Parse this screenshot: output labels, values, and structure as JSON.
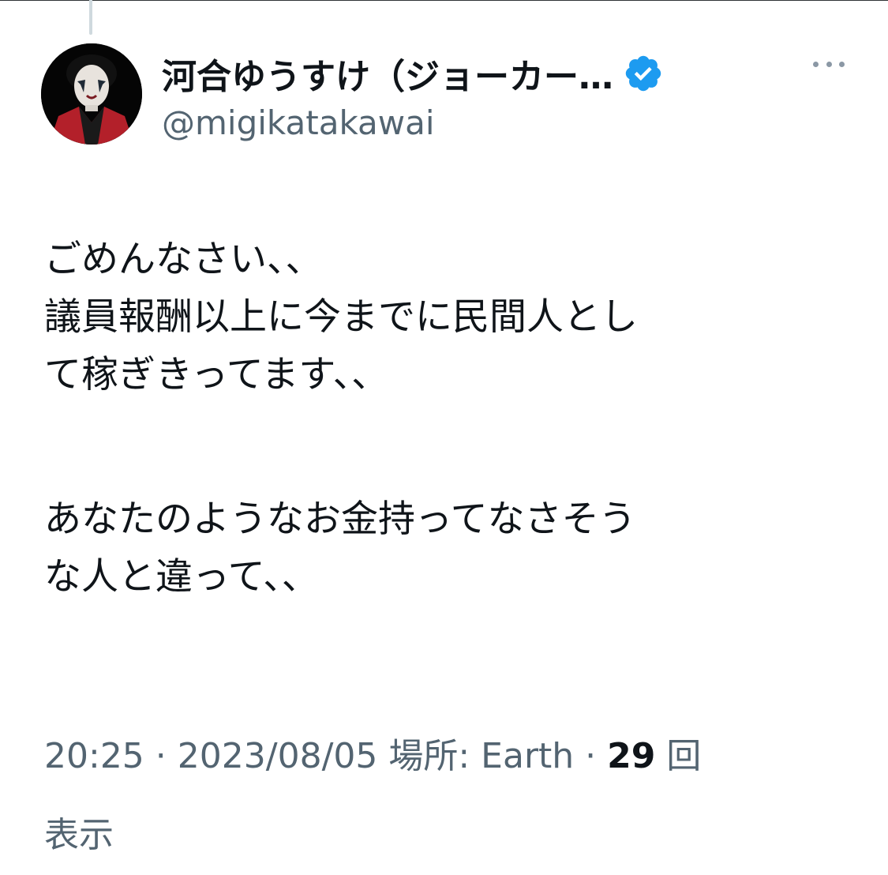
{
  "tweet": {
    "author": {
      "display_name": "河合ゆうすけ（ジョーカー…",
      "handle": "@migikatakawai",
      "verified": true,
      "verified_color": "#1d9bf0"
    },
    "more_icon": "more-horizontal-icon",
    "text_lines": [
      "ごめんなさい、、",
      "議員報酬以上に今までに民間人とし",
      "て稼ぎきってます、、",
      "",
      "あなたのようなお金持ってなさそう",
      "な人と違って、、"
    ],
    "meta": {
      "time": "20:25",
      "separator": " · ",
      "date": "2023/08/05",
      "location_label": " 場所: Earth",
      "views_count": "29",
      "views_unit_line1": " 回",
      "views_unit_line2": "表示"
    }
  },
  "colors": {
    "text_primary": "#0f1419",
    "text_secondary": "#536471",
    "thread_line": "#cfd9de",
    "avatar_accent": "#b3202a"
  }
}
